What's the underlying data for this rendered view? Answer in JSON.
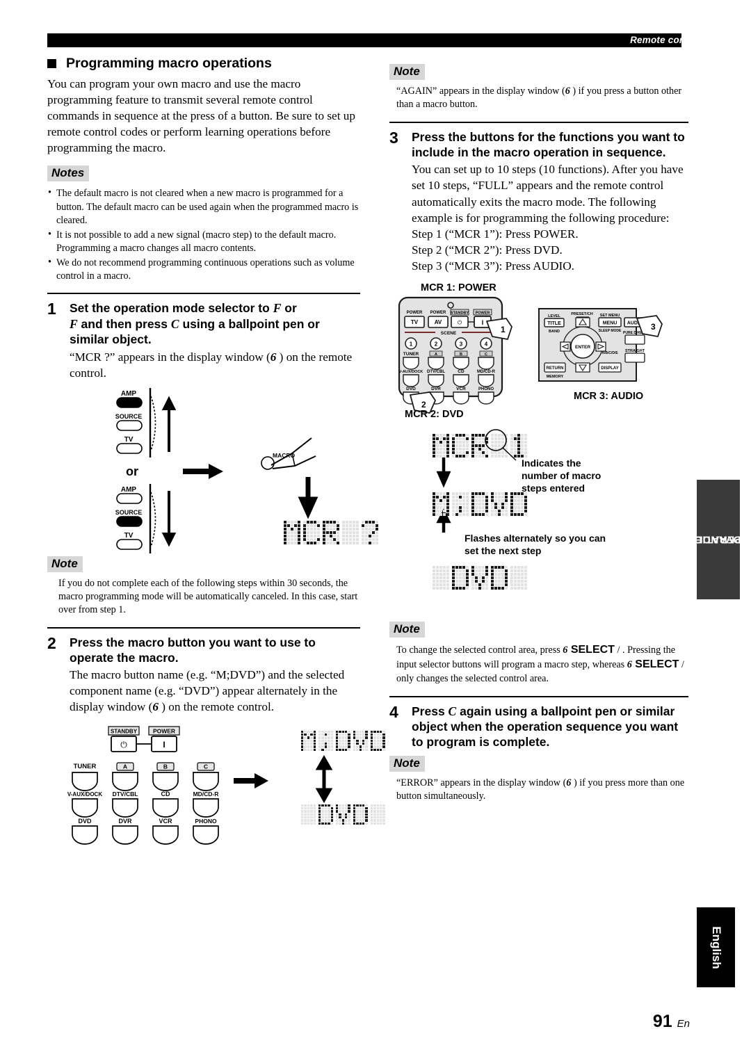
{
  "header": {
    "title": "Remote control features"
  },
  "footer": {
    "page_number": "91",
    "page_lang": "En"
  },
  "side_tabs": {
    "advanced": "ADVANCED\nOPERATION",
    "advanced_line1": "ADVANCED",
    "advanced_line2": "OPERATION",
    "language": "English"
  },
  "left": {
    "section_title": "Programming macro operations",
    "intro": "You can program your own macro and use the macro programming feature to transmit several remote control commands in sequence at the press of a button. Be sure to set up remote control codes or perform learning operations before programming the macro.",
    "notes_label": "Notes",
    "notes": [
      "The default macro is not cleared when a new macro is programmed for a button. The default macro can be used again when the programmed macro is cleared.",
      "It is not possible to add a new signal (macro step) to the default macro. Programming a macro changes all macro contents.",
      "We do not recommend programming continuous operations such as volume control in a macro."
    ],
    "step1": {
      "number": "1",
      "title_pre": "Set the operation mode selector to ",
      "title_sym1": "F",
      "title_mid1": "   or ",
      "title_sym2": "F",
      "title_mid2": "           and then press ",
      "title_sym3": "C",
      "title_mid3": "           using a ballpoint pen or similar object.",
      "body_pre": "“MCR ?” appears in the display window (",
      "body_sym": "6",
      "body_post": " ) on the remote control."
    },
    "fig1": {
      "selector_labels": [
        "AMP",
        "SOURCE",
        "TV"
      ],
      "or_label": "or",
      "macro_label": "MACRO",
      "display_text": "MCR ?"
    },
    "note1": {
      "label": "Note",
      "text": "If you do not complete each of the following steps within 30 seconds, the macro programming mode will be automatically canceled. In this case, start over from step 1."
    },
    "step2": {
      "number": "2",
      "title": "Press the macro button you want to use to operate the macro.",
      "body_pre": "The macro button name (e.g. “M;DVD”) and the selected component name (e.g. “DVD”) appear alternately in the display window (",
      "body_sym": "6",
      "body_post": " ) on the remote control."
    },
    "fig2": {
      "standby_label": "STANDBY",
      "power_label": "POWER",
      "standby_glyph": "⏻",
      "power_glyph": "I",
      "buttons_row1": [
        "TUNER",
        "A",
        "B",
        "C"
      ],
      "buttons_row2": [
        "V-AUX/DOCK",
        "DTV/CBL",
        "CD",
        "MD/CD-R"
      ],
      "buttons_row3": [
        "DVD",
        "DVR",
        "VCR",
        "PHONO"
      ],
      "display_top": "M;DVD",
      "display_bottom": " DVD "
    }
  },
  "right": {
    "note_again": {
      "label": "Note",
      "text_pre": "“AGAIN” appears in the display window (",
      "sym": "6",
      "text_post": " ) if you press a button other than a macro button."
    },
    "step3": {
      "number": "3",
      "title": "Press the buttons for the functions you want to include in the macro operation in sequence.",
      "body": "You can set up to 10 steps (10 functions). After you have set 10 steps, “FULL” appears and the remote control automatically exits the macro mode. The following example is for programming the following procedure:",
      "steps": [
        "Step 1 (“MCR 1”): Press POWER.",
        "Step 2 (“MCR 2”): Press DVD.",
        "Step 3 (“MCR 3”): Press AUDIO."
      ]
    },
    "fig3": {
      "caption_mcr1": "MCR 1: POWER",
      "caption_mcr2": "MCR 2: DVD",
      "caption_mcr3": "MCR 3: AUDIO",
      "callout_1": "1",
      "callout_2": "2",
      "callout_3": "3",
      "remote_top_labels": [
        "POWER",
        "POWER",
        "STANDBY",
        "POWER"
      ],
      "remote_top_buttons": [
        "TV",
        "AV",
        "⏻",
        "I"
      ],
      "scene_label": "SCENE",
      "scene_numbers": [
        "1",
        "2",
        "3",
        "4"
      ],
      "input_row1": [
        "TUNER",
        "A",
        "B",
        "C"
      ],
      "input_row2": [
        "V-AUX/DOCK",
        "DTV/CBL",
        "CD",
        "MD/CD-R"
      ],
      "input_row3": [
        "DVD",
        "DVR",
        "VCR",
        "PHONO"
      ],
      "pad_labels": {
        "level": "LEVEL",
        "title": "TITLE",
        "band": "BAND",
        "preset_ch": "PRESET/CH",
        "set_menu": "SET MENU",
        "menu": "MENU",
        "sleep_mode": "SLEEP MODE",
        "audio": "AUDIO",
        "pure_direct": "PURE DIRECT",
        "enter": "ENTER",
        "abcde": "A/B/C/D/E",
        "straight": "STRAIGHT",
        "return": "RETURN",
        "memory": "MEMORY",
        "display": "DISPLAY"
      },
      "display_mcr1": "MCR 1",
      "display_mdvd": "M;DVD",
      "display_dvd": " DVD ",
      "anno_steps": "Indicates the\nnumber of macro\nsteps entered",
      "anno_steps_l1": "Indicates the",
      "anno_steps_l2": "number of macro",
      "anno_steps_l3": "steps entered",
      "anno_flash_l1": "Flashes alternately so you can",
      "anno_flash_l2": "set the next step"
    },
    "note_select": {
      "label": "Note",
      "p1_pre": "To change the selected control area, press ",
      "p1_sym": "6",
      "p1_mid": " SELECT",
      "p1_slash": "   /   .",
      "p2_pre": "Pressing the input selector buttons will program a macro step, whereas ",
      "p2_sym": "6",
      "p2_mid": " SELECT",
      "p2_post": "   /    only changes the selected control area."
    },
    "step4": {
      "number": "4",
      "title_pre": "Press ",
      "title_sym": "C",
      "title_post": "           again using a ballpoint pen or similar object when the operation sequence you want to program is complete."
    },
    "note_error": {
      "label": "Note",
      "text_pre": "“ERROR” appears in the display window (",
      "sym": "6",
      "text_post": " ) if you press more than one button simultaneously."
    }
  }
}
